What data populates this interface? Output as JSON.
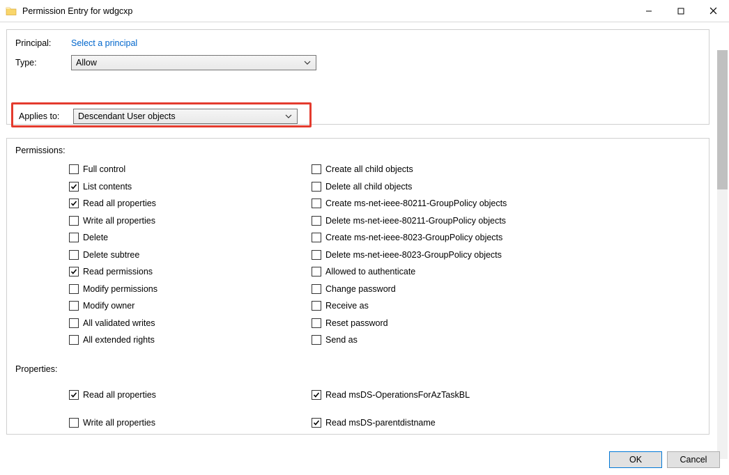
{
  "window": {
    "title": "Permission Entry for wdgcxp"
  },
  "principal": {
    "label": "Principal:",
    "link": "Select a principal"
  },
  "type_row": {
    "label": "Type:",
    "value": "Allow"
  },
  "applies_row": {
    "label": "Applies to:",
    "value": "Descendant User objects"
  },
  "perm_section_label": "Permissions:",
  "perm_left": [
    {
      "label": "Full control",
      "checked": false
    },
    {
      "label": "List contents",
      "checked": true
    },
    {
      "label": "Read all properties",
      "checked": true
    },
    {
      "label": "Write all properties",
      "checked": false
    },
    {
      "label": "Delete",
      "checked": false
    },
    {
      "label": "Delete subtree",
      "checked": false
    },
    {
      "label": "Read permissions",
      "checked": true
    },
    {
      "label": "Modify permissions",
      "checked": false
    },
    {
      "label": "Modify owner",
      "checked": false
    },
    {
      "label": "All validated writes",
      "checked": false
    },
    {
      "label": "All extended rights",
      "checked": false
    }
  ],
  "perm_right": [
    {
      "label": "Create all child objects",
      "checked": false
    },
    {
      "label": "Delete all child objects",
      "checked": false
    },
    {
      "label": "Create ms-net-ieee-80211-GroupPolicy objects",
      "checked": false
    },
    {
      "label": "Delete ms-net-ieee-80211-GroupPolicy objects",
      "checked": false
    },
    {
      "label": "Create ms-net-ieee-8023-GroupPolicy objects",
      "checked": false
    },
    {
      "label": "Delete ms-net-ieee-8023-GroupPolicy objects",
      "checked": false
    },
    {
      "label": "Allowed to authenticate",
      "checked": false
    },
    {
      "label": "Change password",
      "checked": false
    },
    {
      "label": "Receive as",
      "checked": false
    },
    {
      "label": "Reset password",
      "checked": false
    },
    {
      "label": "Send as",
      "checked": false
    }
  ],
  "prop_section_label": "Properties:",
  "prop_left": [
    {
      "label": "Read all properties",
      "checked": true
    },
    {
      "label": "Write all properties",
      "checked": false
    }
  ],
  "prop_right": [
    {
      "label": "Read msDS-OperationsForAzTaskBL",
      "checked": true
    },
    {
      "label": "Read msDS-parentdistname",
      "checked": true
    }
  ],
  "buttons": {
    "ok": "OK",
    "cancel": "Cancel"
  }
}
